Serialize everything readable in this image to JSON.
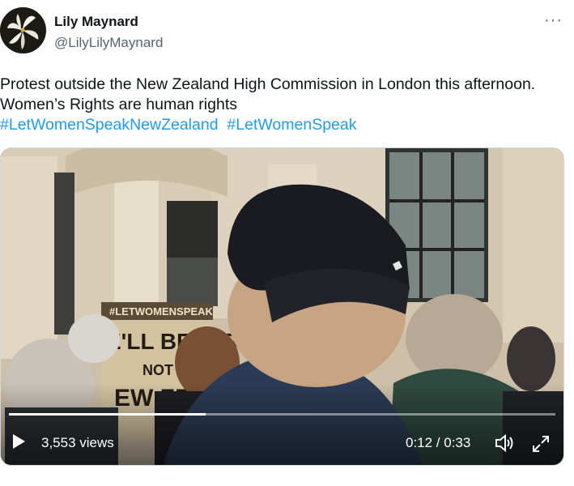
{
  "author": {
    "name": "Lily Maynard",
    "handle": "@LilyLilyMaynard"
  },
  "tweet": {
    "text": "Protest outside the New Zealand High Commission in London this afternoon. Women’s Rights are human rights",
    "hashtags": [
      "#LetWomenSpeakNewZealand",
      "#LetWomenSpeak"
    ]
  },
  "video": {
    "views": "3,553 views",
    "time": "0:12 / 0:33",
    "progress": 0.36,
    "icons": [
      "play-icon",
      "volume-icon",
      "fullscreen-icon"
    ]
  },
  "more_icon": "more-icon",
  "accent_color": "#1d9bf0"
}
